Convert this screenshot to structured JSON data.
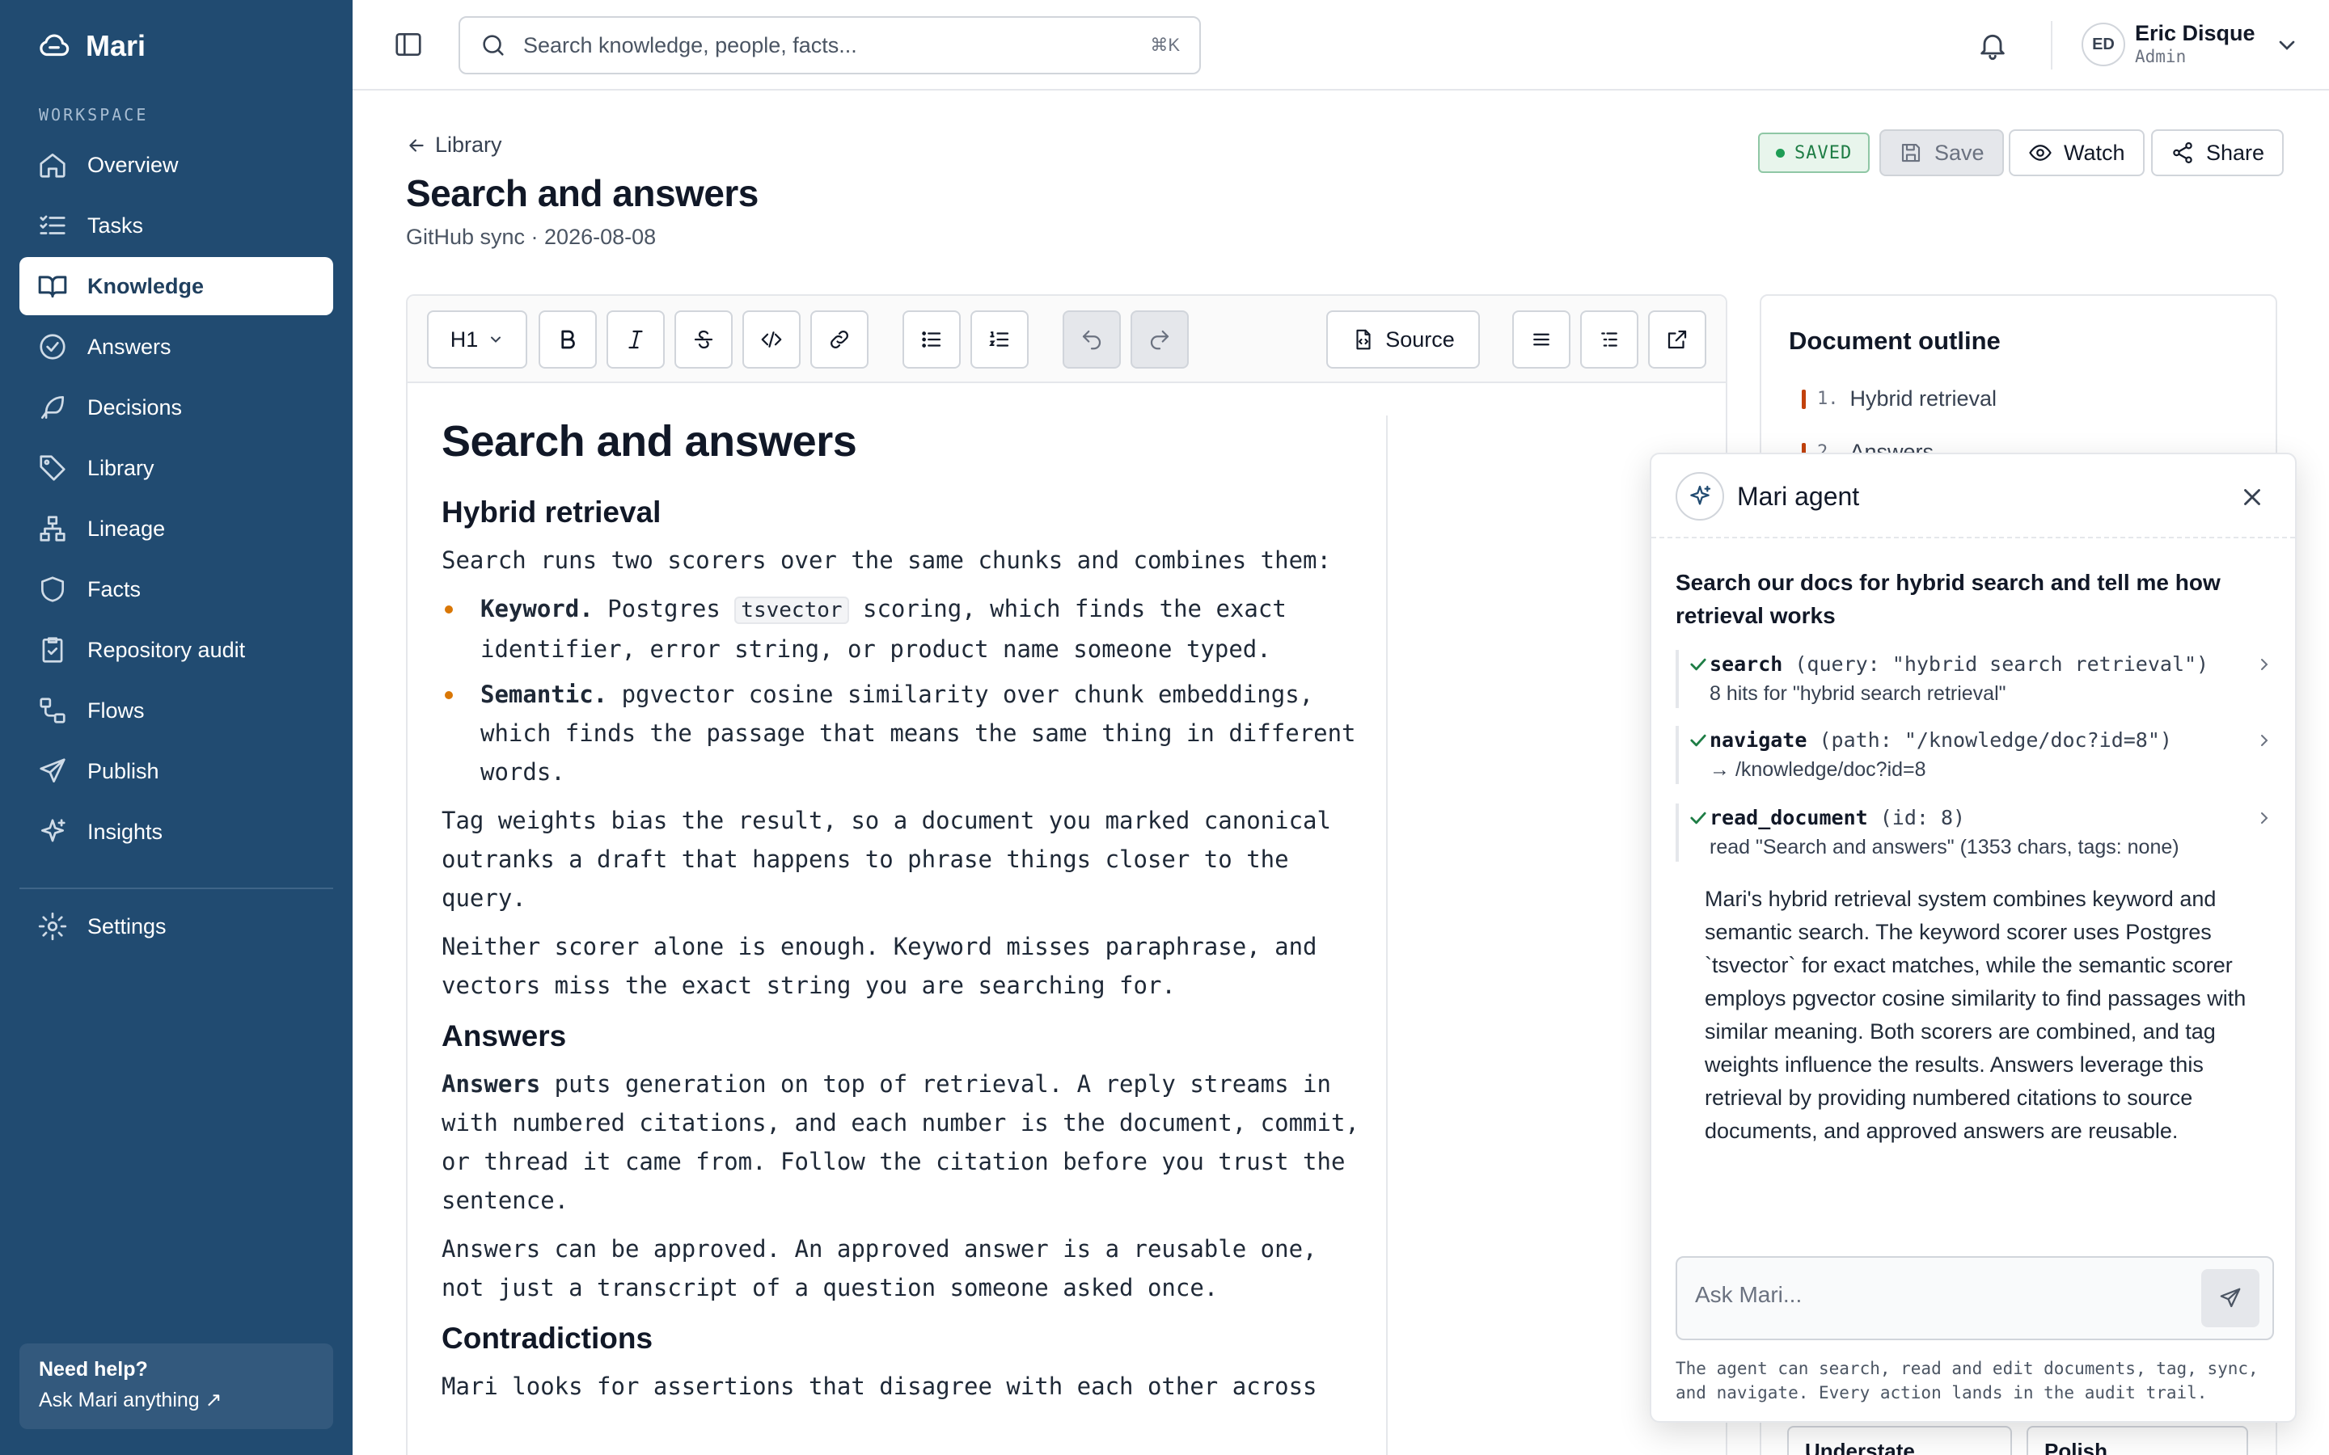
{
  "app": {
    "name": "Mari"
  },
  "sidebar": {
    "section_label": "WORKSPACE",
    "items": [
      {
        "label": "Overview",
        "icon": "home-icon"
      },
      {
        "label": "Tasks",
        "icon": "list-check-icon"
      },
      {
        "label": "Knowledge",
        "icon": "book-icon",
        "active": true
      },
      {
        "label": "Answers",
        "icon": "check-circle-icon"
      },
      {
        "label": "Decisions",
        "icon": "feather-icon"
      },
      {
        "label": "Library",
        "icon": "tag-icon"
      },
      {
        "label": "Lineage",
        "icon": "hierarchy-icon"
      },
      {
        "label": "Facts",
        "icon": "shield-icon"
      },
      {
        "label": "Repository audit",
        "icon": "clipboard-check-icon"
      },
      {
        "label": "Flows",
        "icon": "flow-icon"
      },
      {
        "label": "Publish",
        "icon": "send-icon"
      },
      {
        "label": "Insights",
        "icon": "sparkle-icon"
      }
    ],
    "settings_label": "Settings",
    "help_title": "Need help?",
    "help_link": "Ask Mari anything ↗"
  },
  "topbar": {
    "search_placeholder": "Search knowledge, people, facts...",
    "search_shortcut": "⌘K",
    "user": {
      "initials": "ED",
      "name": "Eric Disque",
      "role": "Admin"
    }
  },
  "page": {
    "breadcrumb": "Library",
    "title": "Search and answers",
    "subtitle": "GitHub sync · 2026-08-08",
    "status": "SAVED",
    "save_label": "Save",
    "watch_label": "Watch",
    "share_label": "Share"
  },
  "toolbar": {
    "heading_select": "H1",
    "source_label": "Source"
  },
  "document": {
    "h1": "Search and answers",
    "s1_title": "Hybrid retrieval",
    "s1_p1": "Search runs two scorers over the same chunks and combines them:",
    "b1_strong": "Keyword.",
    "b1_pre": " Postgres ",
    "b1_code": "tsvector",
    "b1_post": " scoring, which finds the exact identifier, error string, or product name someone typed.",
    "b2_strong": "Semantic.",
    "b2_text": " pgvector cosine similarity over chunk embeddings, which finds the passage that means the same thing in different words.",
    "s1_p2": "Tag weights bias the result, so a document you marked canonical outranks a draft that happens to phrase things closer to the query.",
    "s1_p3": "Neither scorer alone is enough. Keyword misses paraphrase, and vectors miss the exact string you are searching for.",
    "s2_title": "Answers",
    "s2_p1_strong": "Answers",
    "s2_p1_text": " puts generation on top of retrieval. A reply streams in with numbered citations, and each number is the document, commit, or thread it came from. Follow the citation before you trust the sentence.",
    "s2_p2": "Answers can be approved. An approved answer is a reusable one, not just a transcript of a question someone asked once.",
    "s3_title": "Contradictions",
    "s3_p1": "Mari looks for assertions that disagree with each other across"
  },
  "outline": {
    "title": "Document outline",
    "items": [
      {
        "num": "1.",
        "label": "Hybrid retrieval"
      },
      {
        "num": "2.",
        "label": "Answers"
      }
    ],
    "buttons": [
      "Understate",
      "Polish"
    ]
  },
  "agent": {
    "title": "Mari agent",
    "prompt": "Search our docs for hybrid search and tell me how retrieval works",
    "tools": [
      {
        "name": "search",
        "args": " (query: \"hybrid search retrieval\")",
        "result": "8 hits for \"hybrid search retrieval\""
      },
      {
        "name": "navigate",
        "args": " (path: \"/knowledge/doc?id=8\")",
        "result": "→ /knowledge/doc?id=8"
      },
      {
        "name": "read_document",
        "args": " (id: 8)",
        "result": "read \"Search and answers\" (1353 chars, tags: none)"
      }
    ],
    "answer": "Mari's hybrid retrieval system combines keyword and semantic search. The keyword scorer uses Postgres `tsvector` for exact matches, while the semantic scorer employs pgvector cosine similarity to find passages with similar meaning. Both scorers are combined, and tag weights influence the results. Answers leverage this retrieval by providing numbered citations to source documents, and approved answers are reusable.",
    "input_placeholder": "Ask Mari...",
    "footer": "The agent can search, read and edit documents, tag, sync, and navigate. Every action lands in the audit trail."
  },
  "colors": {
    "sidebar_bg": "#214b71",
    "accent": "#c2410c",
    "saved_green": "#1e7d45",
    "bullet": "#d97706"
  }
}
